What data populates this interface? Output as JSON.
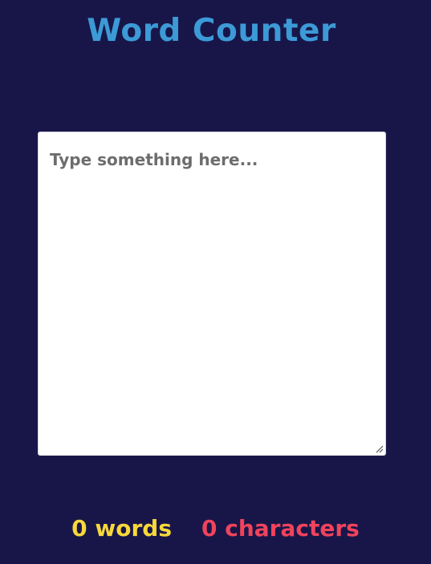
{
  "header": {
    "title": "Word Counter"
  },
  "editor": {
    "placeholder": "Type something here...",
    "value": ""
  },
  "stats": {
    "word_count": "0",
    "word_label": "words",
    "char_count": "0",
    "char_label": "characters"
  },
  "colors": {
    "background": "#181649",
    "title": "#3c9ad6",
    "words": "#f7d83a",
    "characters": "#f0435c"
  },
  "icons": {
    "resize": "resize-grip-icon"
  }
}
